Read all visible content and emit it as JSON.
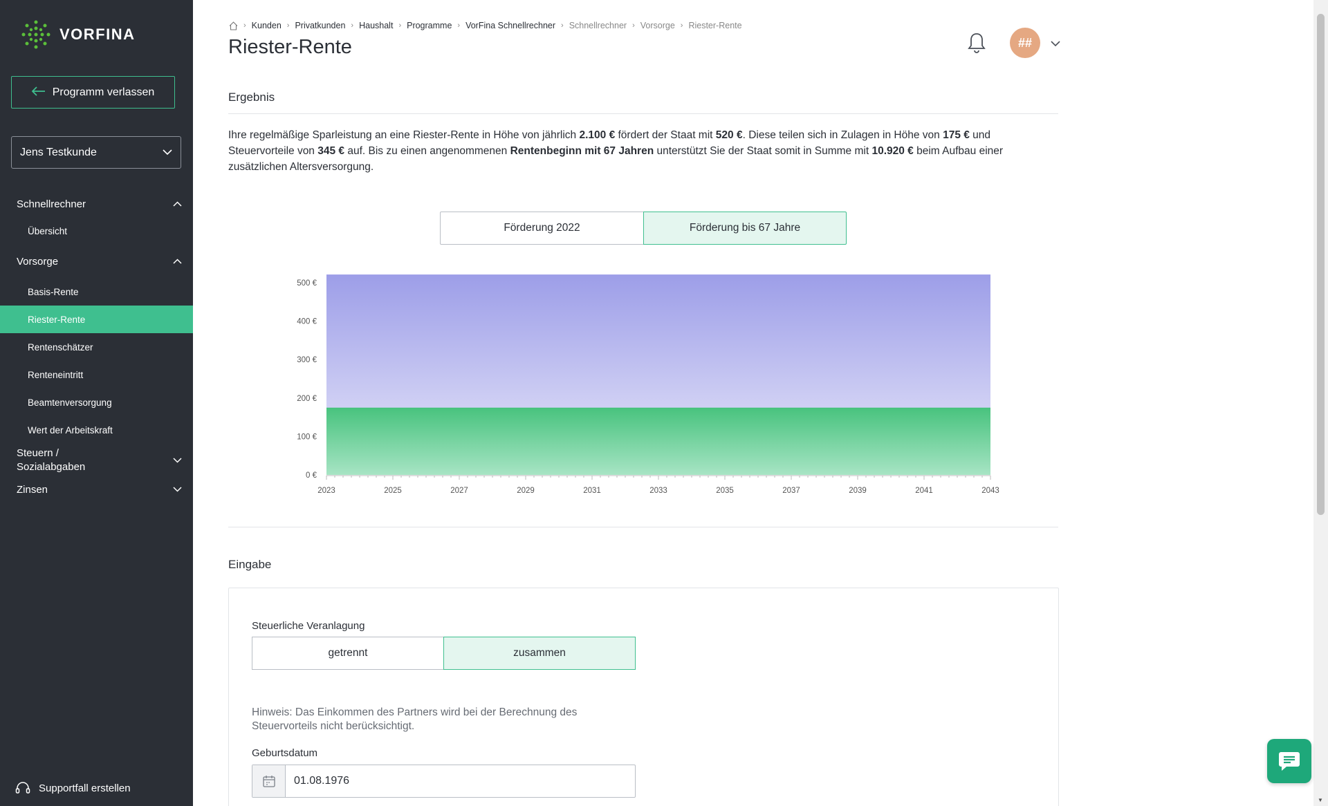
{
  "brand": {
    "name": "VORFINA"
  },
  "sidebar": {
    "exit_label": "Programm verlassen",
    "customer": "Jens Testkunde",
    "groups": [
      {
        "label": "Schnellrechner",
        "expanded": true,
        "items": [
          "Übersicht"
        ]
      },
      {
        "label": "Vorsorge",
        "expanded": true,
        "items": [
          "Basis-Rente",
          "Riester-Rente",
          "Rentenschätzer",
          "Renteneintritt",
          "Beamtenversorgung",
          "Wert der Arbeitskraft"
        ]
      },
      {
        "label": "Steuern / Sozialabgaben",
        "expanded": false,
        "items": []
      },
      {
        "label": "Zinsen",
        "expanded": false,
        "items": []
      }
    ],
    "active_item": "Riester-Rente",
    "support_label": "Supportfall erstellen"
  },
  "breadcrumb": [
    "Kunden",
    "Privatkunden",
    "Haushalt",
    "Programme",
    "VorFina Schnellrechner",
    "Schnellrechner",
    "Vorsorge",
    "Riester-Rente"
  ],
  "page_title": "Riester-Rente",
  "user": {
    "avatar_initials": "##"
  },
  "result": {
    "heading": "Ergebnis",
    "text_parts": [
      {
        "t": "Ihre regelmäßige Sparleistung an eine Riester-Rente in Höhe von jährlich ",
        "b": false
      },
      {
        "t": "2.100 €",
        "b": true
      },
      {
        "t": " fördert der Staat mit ",
        "b": false
      },
      {
        "t": "520 €",
        "b": true
      },
      {
        "t": ". Diese teilen sich in Zulagen in Höhe von ",
        "b": false
      },
      {
        "t": "175 €",
        "b": true
      },
      {
        "t": " und Steuervorteile von ",
        "b": false
      },
      {
        "t": "345 €",
        "b": true
      },
      {
        "t": " auf. Bis zu einen angenommenen ",
        "b": false
      },
      {
        "t": "Rentenbeginn mit 67 Jahren",
        "b": true
      },
      {
        "t": " unterstützt Sie der Staat somit in Summe mit ",
        "b": false
      },
      {
        "t": "10.920 €",
        "b": true
      },
      {
        "t": " beim Aufbau einer zusätzlichen Altersversorgung.",
        "b": false
      }
    ],
    "toggle": {
      "left": "Förderung 2022",
      "right": "Förderung bis 67 Jahre",
      "selected": "right"
    }
  },
  "chart_data": {
    "type": "area",
    "stacked": true,
    "x": [
      2023,
      2043
    ],
    "x_ticks": [
      "2023",
      "2025",
      "2027",
      "2029",
      "2031",
      "2033",
      "2035",
      "2037",
      "2039",
      "2041",
      "2043"
    ],
    "y_ticks": [
      "0 €",
      "100 €",
      "200 €",
      "300 €",
      "400 €",
      "500 €"
    ],
    "ylim": [
      0,
      520
    ],
    "series": [
      {
        "values": [
          175,
          175
        ],
        "color": "#3fbf78"
      },
      {
        "values": [
          345,
          345
        ],
        "color": "#9d9ee8"
      }
    ],
    "grid": false
  },
  "input": {
    "heading": "Eingabe",
    "tax_label": "Steuerliche Veranlagung",
    "tax_options": [
      "getrennt",
      "zusammen"
    ],
    "tax_selected": "zusammen",
    "hint": "Hinweis: Das Einkommen des Partners wird bei der Berechnung des Steuervorteils nicht berücksichtigt.",
    "birth_label": "Geburtsdatum",
    "birth_value": "01.08.1976"
  },
  "colors": {
    "accent": "#3fbf8f",
    "sidebar": "#2b2f36",
    "chat": "#1ea87a"
  }
}
